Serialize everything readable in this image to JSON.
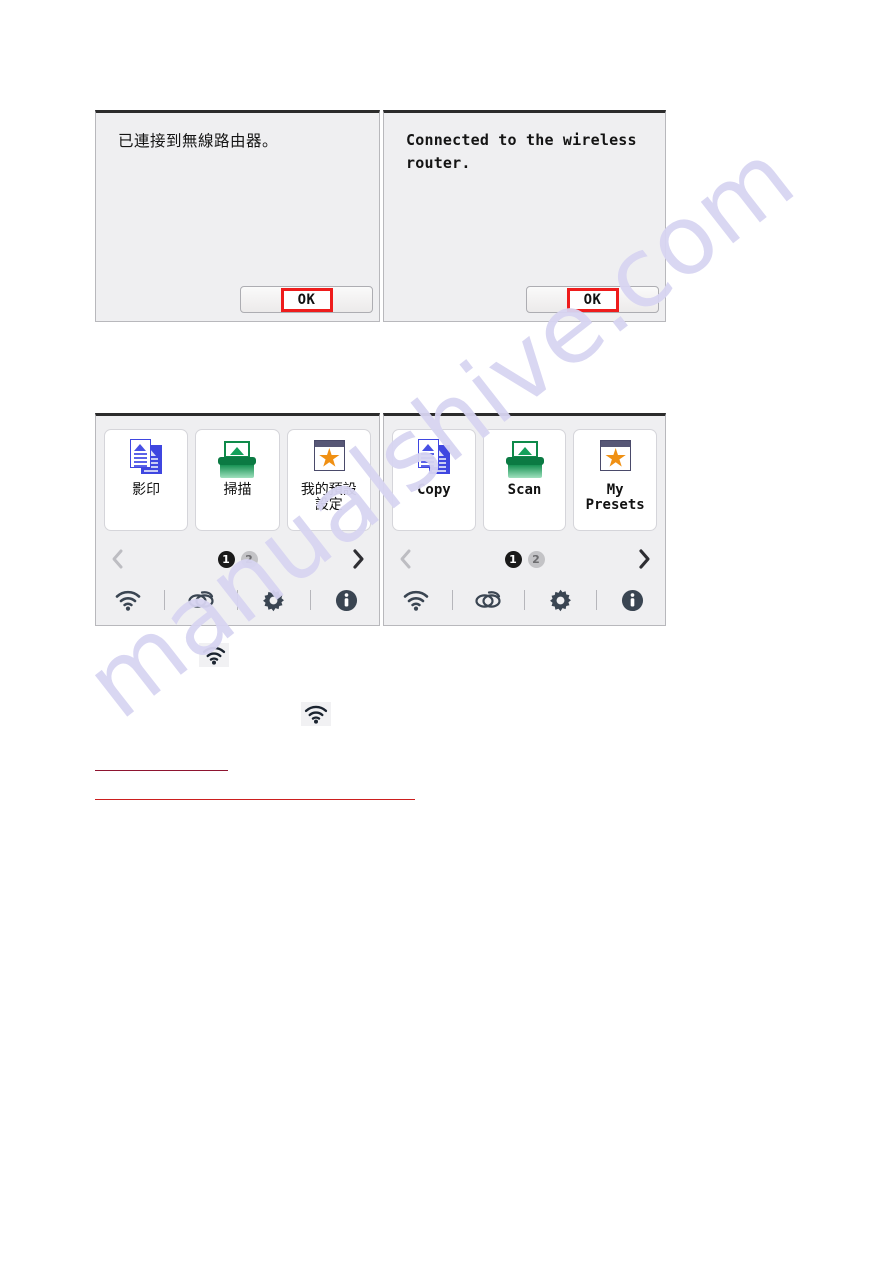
{
  "watermark": {
    "text": "manualshive.com"
  },
  "dialogs": [
    {
      "id": "dialog-zh",
      "language": "zh-TW",
      "message": "已連接到無線路由器。",
      "ok_label": "OK"
    },
    {
      "id": "dialog-en",
      "language": "en",
      "message": "Connected to the wireless router.",
      "ok_label": "OK"
    }
  ],
  "home_screens": [
    {
      "id": "home-zh",
      "language": "zh-TW",
      "tiles": [
        {
          "icon": "copy-icon",
          "label": "影印"
        },
        {
          "icon": "scan-icon",
          "label": "掃描"
        },
        {
          "icon": "my-presets-icon",
          "label": "我的預設\n設定"
        }
      ],
      "pager": {
        "prev_icon": "chevron-left-icon",
        "next_icon": "chevron-right-icon",
        "pages": [
          "1",
          "2"
        ],
        "active_page": "1"
      },
      "status_icons": [
        "wifi-icon",
        "wireless-direct-icon",
        "gear-icon",
        "info-icon"
      ]
    },
    {
      "id": "home-en",
      "language": "en",
      "tiles": [
        {
          "icon": "copy-icon",
          "label": "Copy"
        },
        {
          "icon": "scan-icon",
          "label": "Scan"
        },
        {
          "icon": "my-presets-icon",
          "label": "My\nPresets"
        }
      ],
      "pager": {
        "prev_icon": "chevron-left-icon",
        "next_icon": "chevron-right-icon",
        "pages": [
          "1",
          "2"
        ],
        "active_page": "1"
      },
      "status_icons": [
        "wifi-icon",
        "wireless-direct-icon",
        "gear-icon",
        "info-icon"
      ]
    }
  ],
  "inline_icons": [
    {
      "id": "wifi-inline-1",
      "icon": "wifi-icon"
    },
    {
      "id": "wifi-inline-2",
      "icon": "wifi-icon"
    }
  ],
  "link_rules": [
    {
      "id": "link-rule-1",
      "color": "#8e1430"
    },
    {
      "id": "link-rule-2",
      "color": "#cc1f1f"
    }
  ],
  "colors": {
    "panel_bg": "#efeff1",
    "panel_border": "#b8b8bc",
    "panel_top_border": "#2b2b2b",
    "highlight_red": "#ee1c1c",
    "copy_blue": "#3f46e0",
    "scan_green": "#0b7a43",
    "star_orange": "#f09013",
    "preset_frame": "#575776",
    "status_icon": "#3a4552",
    "watermark": "#d8d5f2"
  }
}
